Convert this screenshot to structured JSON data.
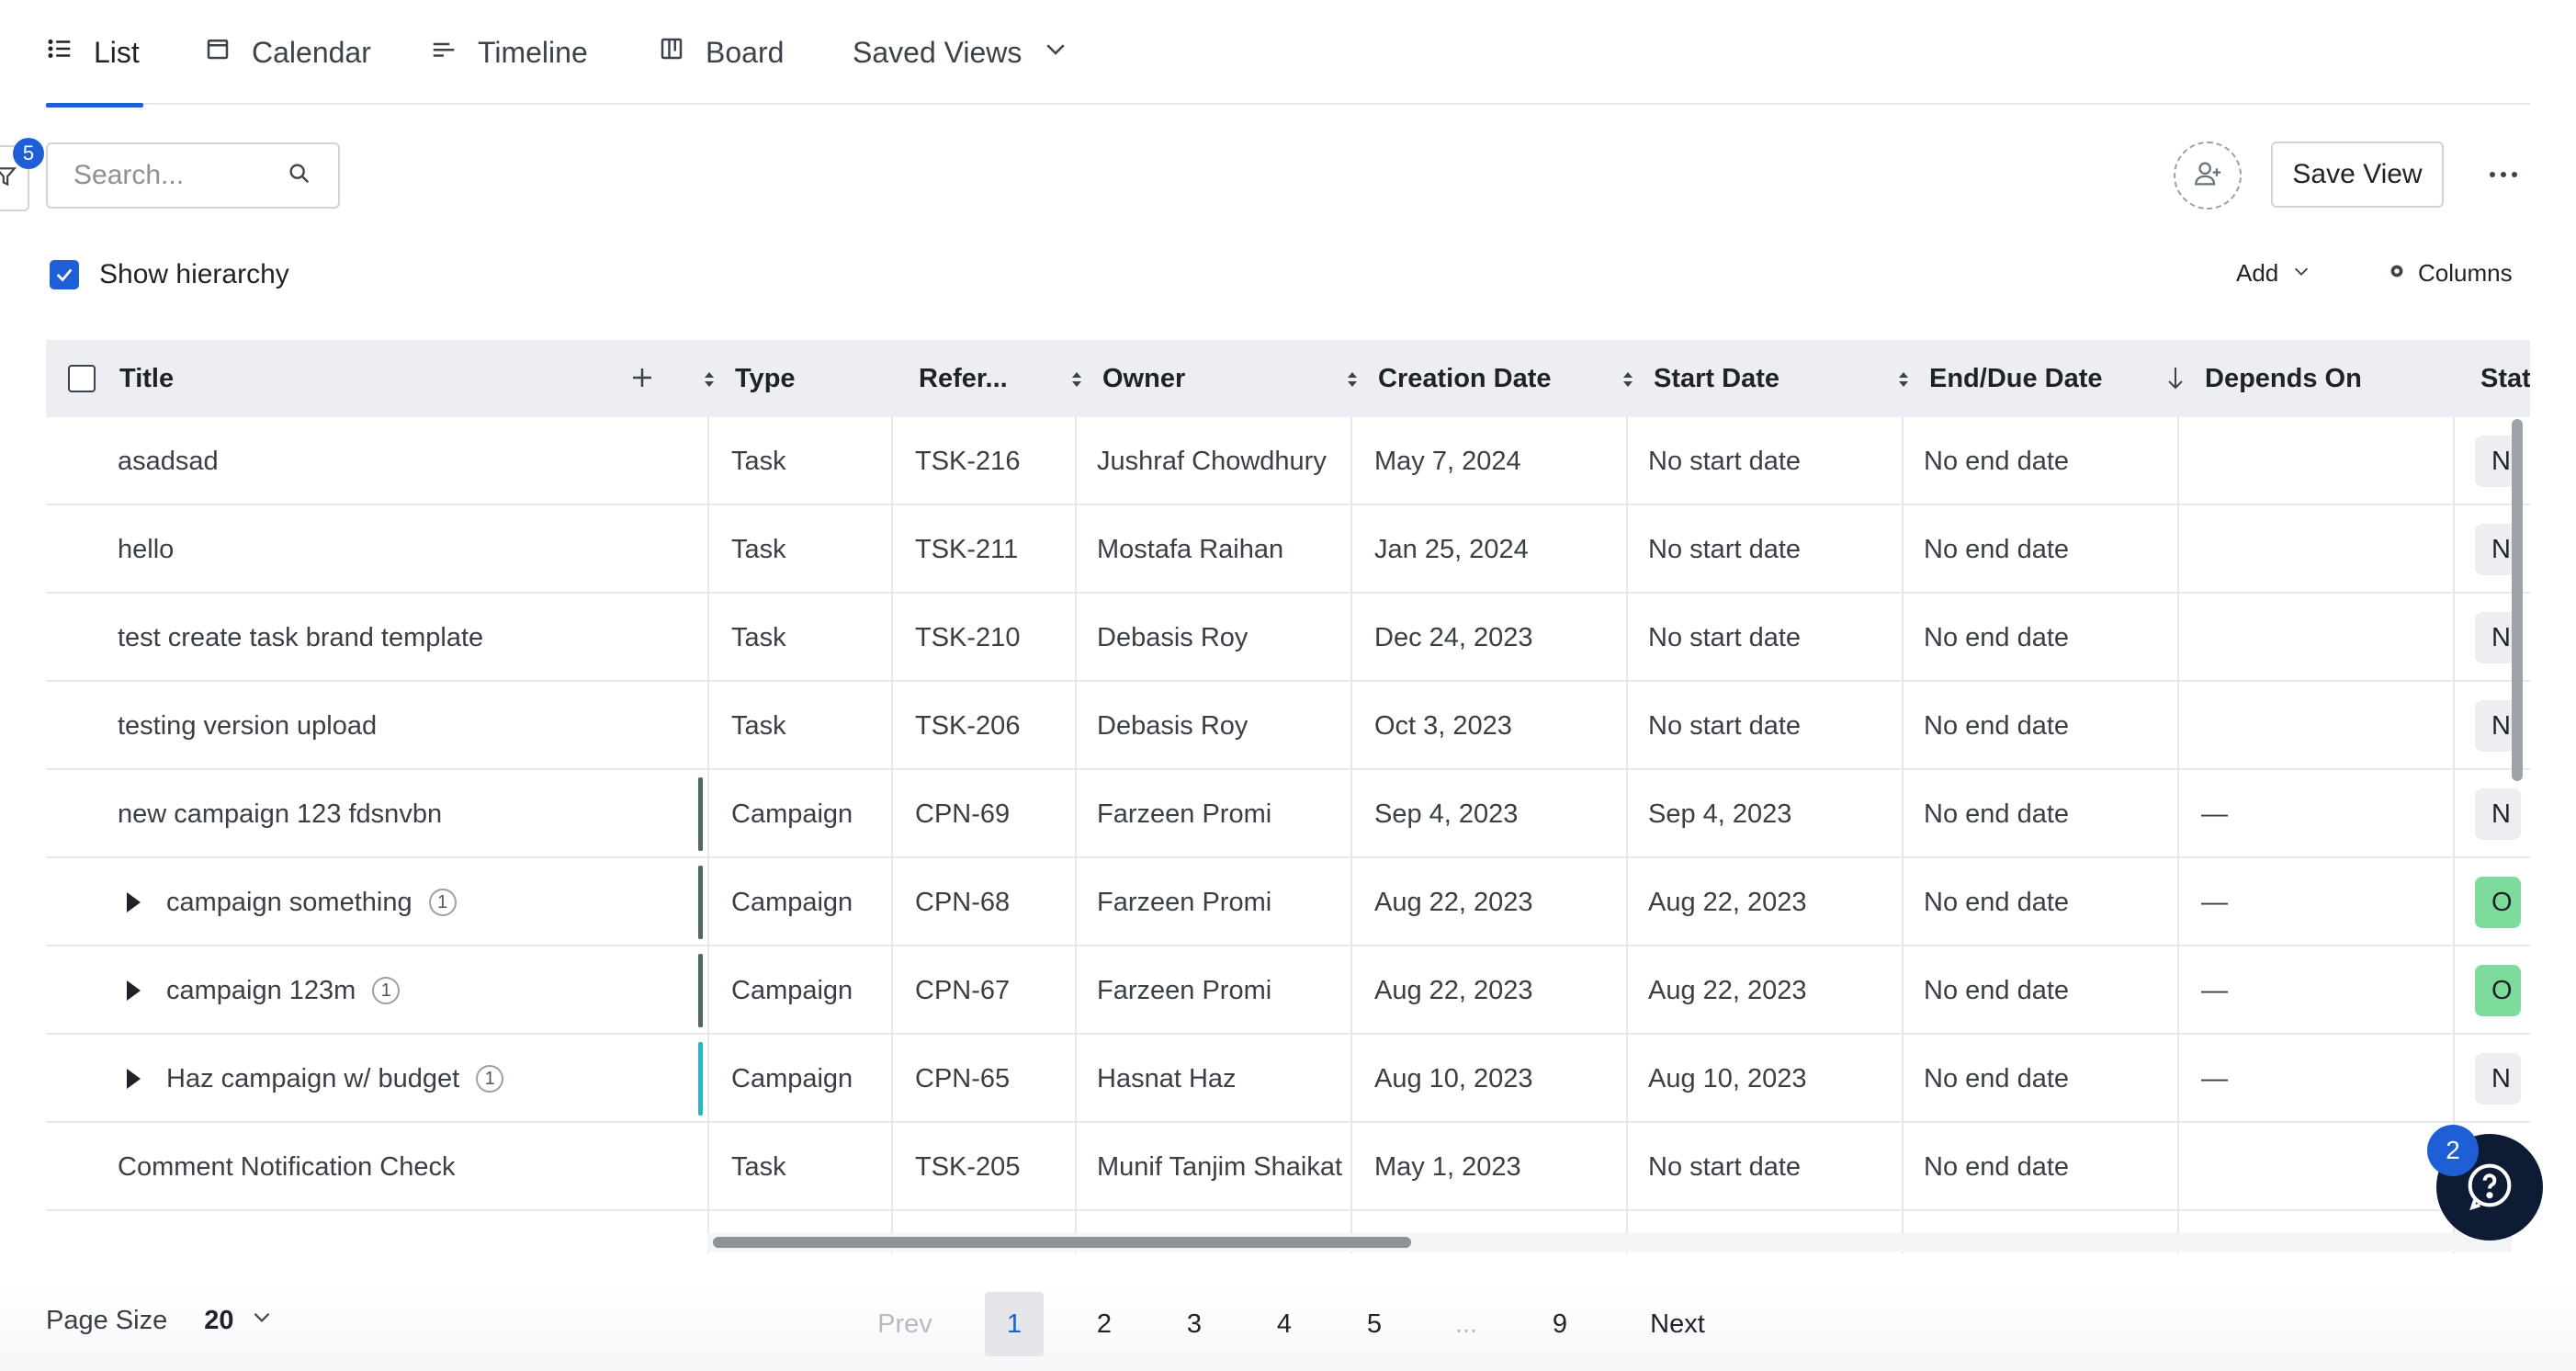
{
  "tabs": [
    {
      "label": "List",
      "icon": "list-icon",
      "active": true
    },
    {
      "label": "Calendar",
      "icon": "calendar-icon"
    },
    {
      "label": "Timeline",
      "icon": "timeline-icon"
    },
    {
      "label": "Board",
      "icon": "board-icon"
    },
    {
      "label": "Saved Views",
      "icon": "chevron-down-icon"
    }
  ],
  "filter": {
    "badge": "5"
  },
  "search": {
    "placeholder": "Search..."
  },
  "toolbar": {
    "save_view": "Save View",
    "show_hierarchy": "Show hierarchy",
    "add": "Add",
    "columns": "Columns"
  },
  "columns": [
    "Title",
    "Type",
    "Refer...",
    "Owner",
    "Creation Date",
    "Start Date",
    "End/Due Date",
    "Depends On",
    "Statu"
  ],
  "rows": [
    {
      "title": "asadsad",
      "type": "Task",
      "ref": "TSK-216",
      "owner": "Jushraf Chowdhury",
      "created": "May 7, 2024",
      "start": "No start date",
      "end": "No end date",
      "depends": "",
      "status": "N"
    },
    {
      "title": "hello",
      "type": "Task",
      "ref": "TSK-211",
      "owner": "Mostafa Raihan",
      "created": "Jan 25, 2024",
      "start": "No start date",
      "end": "No end date",
      "depends": "",
      "status": "N"
    },
    {
      "title": "test create task brand template",
      "type": "Task",
      "ref": "TSK-210",
      "owner": "Debasis Roy",
      "created": "Dec 24, 2023",
      "start": "No start date",
      "end": "No end date",
      "depends": "",
      "status": "N"
    },
    {
      "title": "testing version upload",
      "type": "Task",
      "ref": "TSK-206",
      "owner": "Debasis Roy",
      "created": "Oct 3, 2023",
      "start": "No start date",
      "end": "No end date",
      "depends": "",
      "status": "N"
    },
    {
      "title": "new campaign 123 fdsnvbn",
      "type": "Campaign",
      "ref": "CPN-69",
      "owner": "Farzeen Promi",
      "created": "Sep 4, 2023",
      "start": "Sep 4, 2023",
      "end": "No end date",
      "depends": "—",
      "status": "N"
    },
    {
      "title": "campaign something",
      "count": "1",
      "type": "Campaign",
      "ref": "CPN-68",
      "owner": "Farzeen Promi",
      "created": "Aug 22, 2023",
      "start": "Aug 22, 2023",
      "end": "No end date",
      "depends": "—",
      "status": "O"
    },
    {
      "title": "campaign 123m",
      "count": "1",
      "type": "Campaign",
      "ref": "CPN-67",
      "owner": "Farzeen Promi",
      "created": "Aug 22, 2023",
      "start": "Aug 22, 2023",
      "end": "No end date",
      "depends": "—",
      "status": "O"
    },
    {
      "title": "Haz campaign w/ budget",
      "count": "1",
      "type": "Campaign",
      "ref": "CPN-65",
      "owner": "Hasnat Haz",
      "created": "Aug 10, 2023",
      "start": "Aug 10, 2023",
      "end": "No end date",
      "depends": "—",
      "status": "N"
    },
    {
      "title": "Comment Notification Check",
      "type": "Task",
      "ref": "TSK-205",
      "owner": "Munif Tanjim Shaikat",
      "created": "May 1, 2023",
      "start": "No start date",
      "end": "No end date",
      "depends": "",
      "status": ""
    }
  ],
  "pagination": {
    "page_size_label": "Page Size",
    "page_size": "20",
    "prev": "Prev",
    "pages": [
      "1",
      "2",
      "3",
      "4",
      "5",
      "...",
      "9"
    ],
    "current": "1",
    "next": "Next"
  },
  "help": {
    "badge": "2"
  },
  "colors": {
    "accent": "#1f5fd6",
    "campaign_dark": "#4e6b5e",
    "campaign_teal": "#2bb4c6",
    "status_gray": "#eceef1",
    "status_green": "#7ddc9c"
  }
}
